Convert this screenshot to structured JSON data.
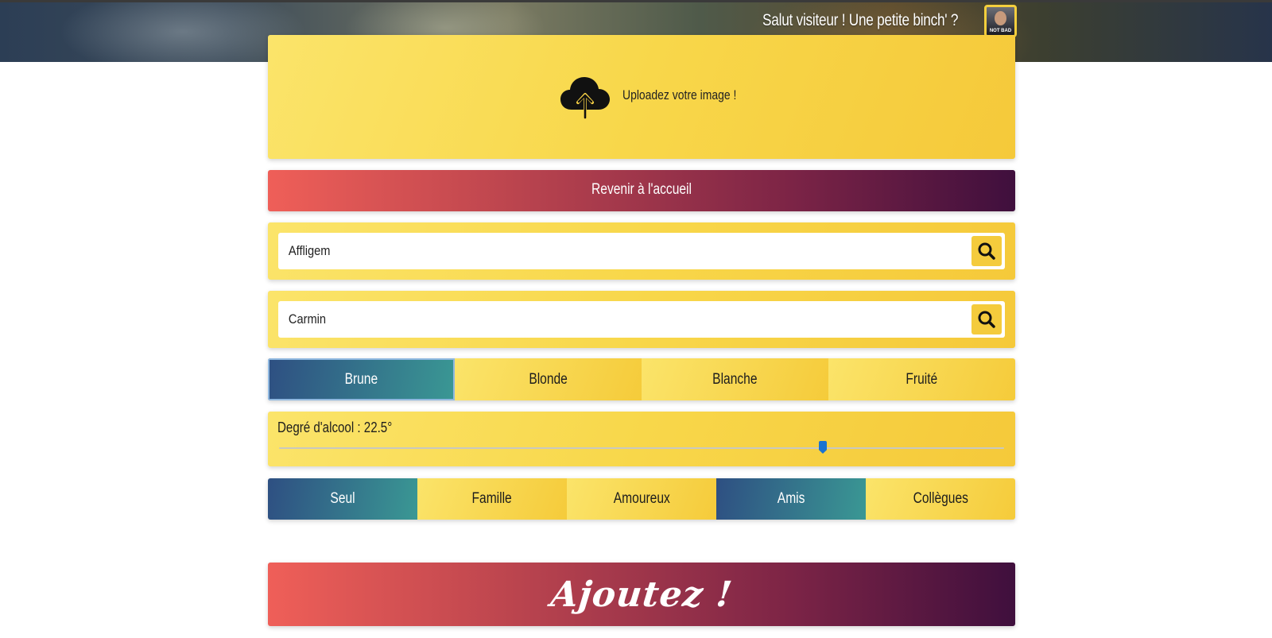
{
  "header": {
    "greeting": "Salut visiteur ! Une petite binch' ?",
    "avatar_caption": "NOT BAD"
  },
  "upload": {
    "label": "Uploadez votre image !",
    "icon": "cloud-upload-icon"
  },
  "back_button": {
    "label": "Revenir à l'accueil"
  },
  "search_brand": {
    "value": "Affligem",
    "icon": "search-icon"
  },
  "search_color": {
    "value": "Carmin",
    "icon": "search-icon"
  },
  "beer_types": {
    "options": [
      "Brune",
      "Blonde",
      "Blanche",
      "Fruité"
    ],
    "selected": "Brune"
  },
  "alcohol": {
    "label": "Degré d'alcool : 22.5°",
    "value": 22.5,
    "fraction": 0.75
  },
  "audience": {
    "options": [
      "Seul",
      "Famille",
      "Amoureux",
      "Amis",
      "Collègues"
    ],
    "selected": [
      "Seul",
      "Amis"
    ]
  },
  "add_button": {
    "label": "Ajoutez !"
  },
  "colors": {
    "accent_yellow": "#f8d74a",
    "gradient_red": "#ef5f58",
    "gradient_purple": "#3f0f3d",
    "selected_blue": "#2e4f82",
    "selected_teal": "#3a9894",
    "slider_thumb": "#1a73d2"
  }
}
